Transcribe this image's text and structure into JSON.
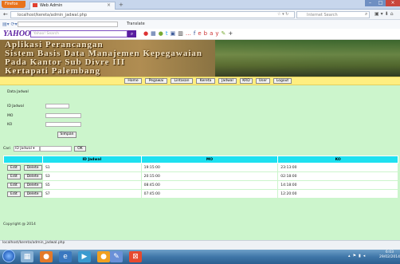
{
  "browser": {
    "app_button": "Firefox",
    "tab_title": "Web Admin",
    "url": "localhost/kereta/admin_jadwal.php",
    "search_placeholder": "Internet Search",
    "translate_label": "Translate"
  },
  "yahoo": {
    "logo": "YAHOO!",
    "search_placeholder": "Yahoo! Search"
  },
  "banner": {
    "line1": "Aplikasi Perancangan",
    "line2": "Sistem Basis Data Manajemen Kepegawaian",
    "line3": "Pada Kantor Sub Divre III",
    "line4": "Kertapati Palembang"
  },
  "menu": [
    "Home",
    "Pegawai",
    "Lintasan",
    "Kereta",
    "Jadwal",
    "KRD",
    "User",
    "Logout"
  ],
  "form": {
    "section_title": "Data Jadwal",
    "id_label": "ID Jadwal",
    "mo_label": "MO",
    "ko_label": "KO",
    "submit": "Simpan"
  },
  "search": {
    "label": "Cari",
    "select_value": "ID Jadwal",
    "button": "OK"
  },
  "table": {
    "headers": [
      "ID Jadwal",
      "MO",
      "KO"
    ],
    "edit_label": "Edit",
    "delete_label": "Delete",
    "rows": [
      {
        "id": "S1",
        "mo": "19:15:00",
        "ko": "23:13:00"
      },
      {
        "id": "S3",
        "mo": "20:15:00",
        "ko": "02:18:00"
      },
      {
        "id": "S5",
        "mo": "08:45:00",
        "ko": "14:18:00"
      },
      {
        "id": "S7",
        "mo": "07:45:00",
        "ko": "12:20:00"
      }
    ]
  },
  "copyright": "Copyright @ 2014",
  "status_url": "localhost/kereta/admin_jadwal.php",
  "clock": {
    "time": "6:03",
    "date": "29/02/2014"
  }
}
